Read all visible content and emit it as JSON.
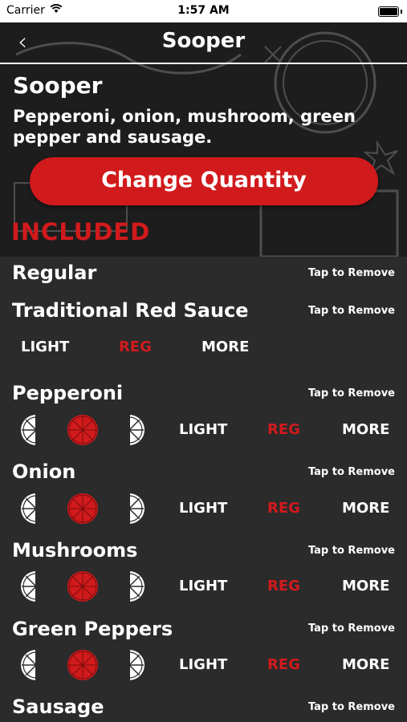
{
  "status": {
    "carrier": "Carrier",
    "time": "1:57 AM"
  },
  "nav": {
    "title": "Sooper"
  },
  "product": {
    "name": "Sooper",
    "desc_line1": "Pepperoni, onion, mushroom, green",
    "desc_line2": "pepper and sausage."
  },
  "quantity_button": "Change Quantity",
  "section_label": "INCLUDED",
  "remove_label": "Tap to Remove",
  "amounts": {
    "light": "LIGHT",
    "reg": "REG",
    "more": "MORE"
  },
  "items": [
    {
      "name": "Regular"
    },
    {
      "name": "Traditional Red Sauce"
    },
    {
      "name": "Pepperoni"
    },
    {
      "name": "Onion"
    },
    {
      "name": "Mushrooms"
    },
    {
      "name": "Green Peppers"
    },
    {
      "name": "Sausage"
    }
  ],
  "colors": {
    "accent": "#d11a1c",
    "background": "#2b2b2b"
  }
}
